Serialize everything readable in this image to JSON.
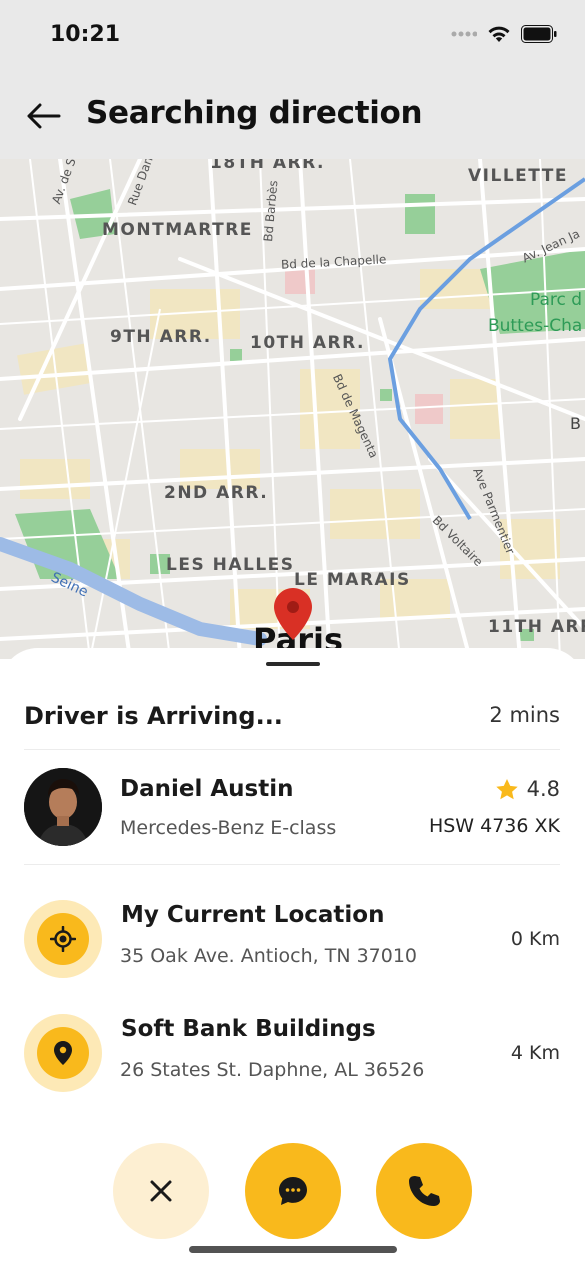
{
  "status_bar": {
    "time": "10:21"
  },
  "header": {
    "title": "Searching direction",
    "back_icon": "arrow-left-icon"
  },
  "map": {
    "districts": [
      "18TH ARR.",
      "VILLETTE",
      "MONTMARTRE",
      "9TH ARR.",
      "10TH ARR.",
      "2ND ARR.",
      "LES HALLES",
      "LE MARAIS",
      "11TH ARR"
    ],
    "streets": [
      "Av. de S",
      "Rue Dan",
      "Bd Barbès",
      "Bd de la Chapelle",
      "Av. Jean Ja",
      "Bd de Magenta",
      "Ave Parmentier",
      "Bd Voltaire",
      "Seine",
      "B"
    ],
    "parks": [
      "Parc d",
      "Buttes-Cha"
    ],
    "city": "Paris"
  },
  "driver_status": {
    "label": "Driver is Arriving...",
    "eta": "2 mins"
  },
  "driver": {
    "name": "Daniel Austin",
    "car": "Mercedes-Benz E-class",
    "rating": "4.8",
    "plate": "HSW 4736 XK"
  },
  "route": [
    {
      "title": "My Current Location",
      "address": "35 Oak Ave. Antioch, TN 37010",
      "distance": "0 Km",
      "icon": "crosshair-icon"
    },
    {
      "title": "Soft Bank Buildings",
      "address": "26 States St. Daphne, AL 36526",
      "distance": "4 Km",
      "icon": "map-pin-icon"
    }
  ],
  "actions": {
    "cancel_icon": "close-icon",
    "chat_icon": "chat-bubble-icon",
    "call_icon": "phone-icon"
  },
  "colors": {
    "accent": "#F9B91C",
    "accent_light": "#FDE9B6",
    "pin": "#D93025",
    "map_bg": "#E8E6E2"
  }
}
